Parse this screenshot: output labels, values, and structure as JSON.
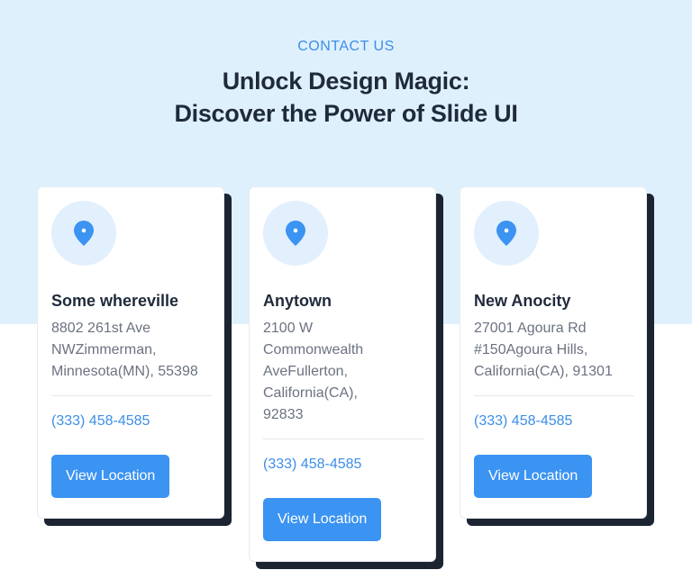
{
  "header": {
    "eyebrow": "CONTACT US",
    "title_line1": "Unlock Design Magic:",
    "title_line2": "Discover the Power of Slide UI"
  },
  "colors": {
    "accent": "#3b93f2",
    "hero_background": "#dff0fd",
    "card_shadow": "#1b2430"
  },
  "cards": [
    {
      "icon": "location-pin-icon",
      "title": "Some whereville",
      "address": "8802 261st Ave NWZimmerman, Minnesota(MN), 55398",
      "phone": "(333) 458-4585",
      "button_label": "View Location"
    },
    {
      "icon": "location-pin-icon",
      "title": "Anytown",
      "address": "2100 W Commonwealth AveFullerton, California(CA), 92833",
      "phone": "(333) 458-4585",
      "button_label": "View Location"
    },
    {
      "icon": "location-pin-icon",
      "title": "New Anocity",
      "address": "27001 Agoura Rd #150Agoura Hills, California(CA), 91301",
      "phone": "(333) 458-4585",
      "button_label": "View Location"
    }
  ]
}
